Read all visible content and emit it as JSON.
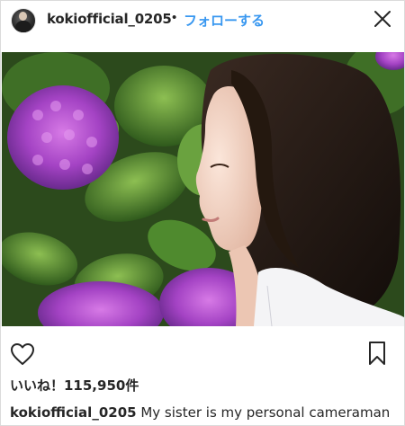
{
  "header": {
    "username": "kokiofficial_0205",
    "separator": "•",
    "follow_label": "フォローする"
  },
  "icons": {
    "more": "close-icon",
    "like": "heart-icon",
    "save": "bookmark-icon"
  },
  "photo": {
    "description_colors": {
      "foliage": "#3d6b26",
      "hydrangea": "#b04fc9",
      "hair": "#1b1410",
      "skin": "#f1d4c4",
      "shirt": "#f4f4f6"
    }
  },
  "engagement": {
    "likes_label": "いいね！115,950件"
  },
  "caption": {
    "username": "kokiofficial_0205",
    "text": " My sister is my personal cameraman"
  },
  "colors": {
    "accent": "#3897f0",
    "text": "#262626",
    "border": "#dbdbdb"
  }
}
